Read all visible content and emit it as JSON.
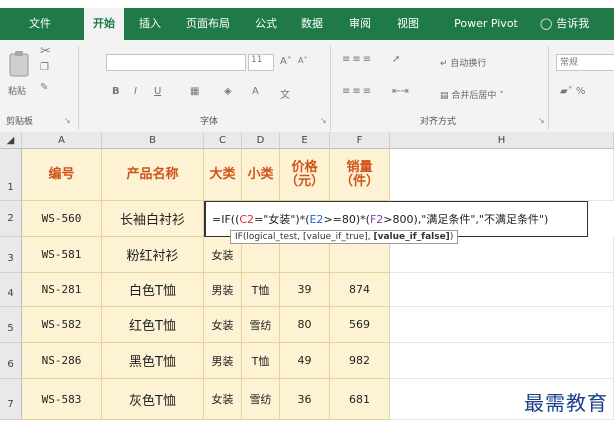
{
  "ribbon_tabs": [
    "文件",
    "开始",
    "插入",
    "页面布局",
    "公式",
    "数据",
    "审阅",
    "视图",
    "Power Pivot",
    "告诉我"
  ],
  "ribbon": {
    "paste_label": "粘贴",
    "clipboard_label": "剪贴板",
    "font_label": "字体",
    "align_label": "对齐方式",
    "font_size": "11",
    "font_grow": "A˄",
    "font_shrink": "A˅",
    "bold": "B",
    "italic": "I",
    "underline": "U",
    "wrap_text": "自动换行",
    "merge_center": "合并后居中",
    "number_format": "常规"
  },
  "columns": [
    "A",
    "B",
    "C",
    "D",
    "E",
    "F",
    "H"
  ],
  "rows": [
    "1",
    "2",
    "3",
    "4",
    "5",
    "6",
    "7"
  ],
  "headers": [
    "编号",
    "产品名称",
    "大类",
    "小类",
    "价格\n（元）",
    "销量\n（件）"
  ],
  "table": [
    [
      "WS-560",
      "长袖白衬衫",
      "",
      "",
      "",
      ""
    ],
    [
      "WS-581",
      "粉红衬衫",
      "女装",
      "",
      "",
      ""
    ],
    [
      "NS-281",
      "白色T恤",
      "男装",
      "T恤",
      "39",
      "874"
    ],
    [
      "WS-582",
      "红色T恤",
      "女装",
      "雪纺",
      "80",
      "569"
    ],
    [
      "NS-286",
      "黑色T恤",
      "男装",
      "T恤",
      "49",
      "982"
    ],
    [
      "WS-583",
      "灰色T恤",
      "女装",
      "雪纺",
      "36",
      "681"
    ]
  ],
  "formula": {
    "p1": "=IF((",
    "p2": "C2",
    "p3": "=\"女装\")*(",
    "p4": "E2",
    "p5": ">=80)*(",
    "p6": "F2",
    "p7": ">800),\"满足条件\",\"不满足条件\")"
  },
  "tooltip": {
    "prefix": "IF(logical_test, [value_if_true], ",
    "bold_arg": "[value_if_false]",
    "suffix": ")"
  },
  "watermark": "最需教育"
}
